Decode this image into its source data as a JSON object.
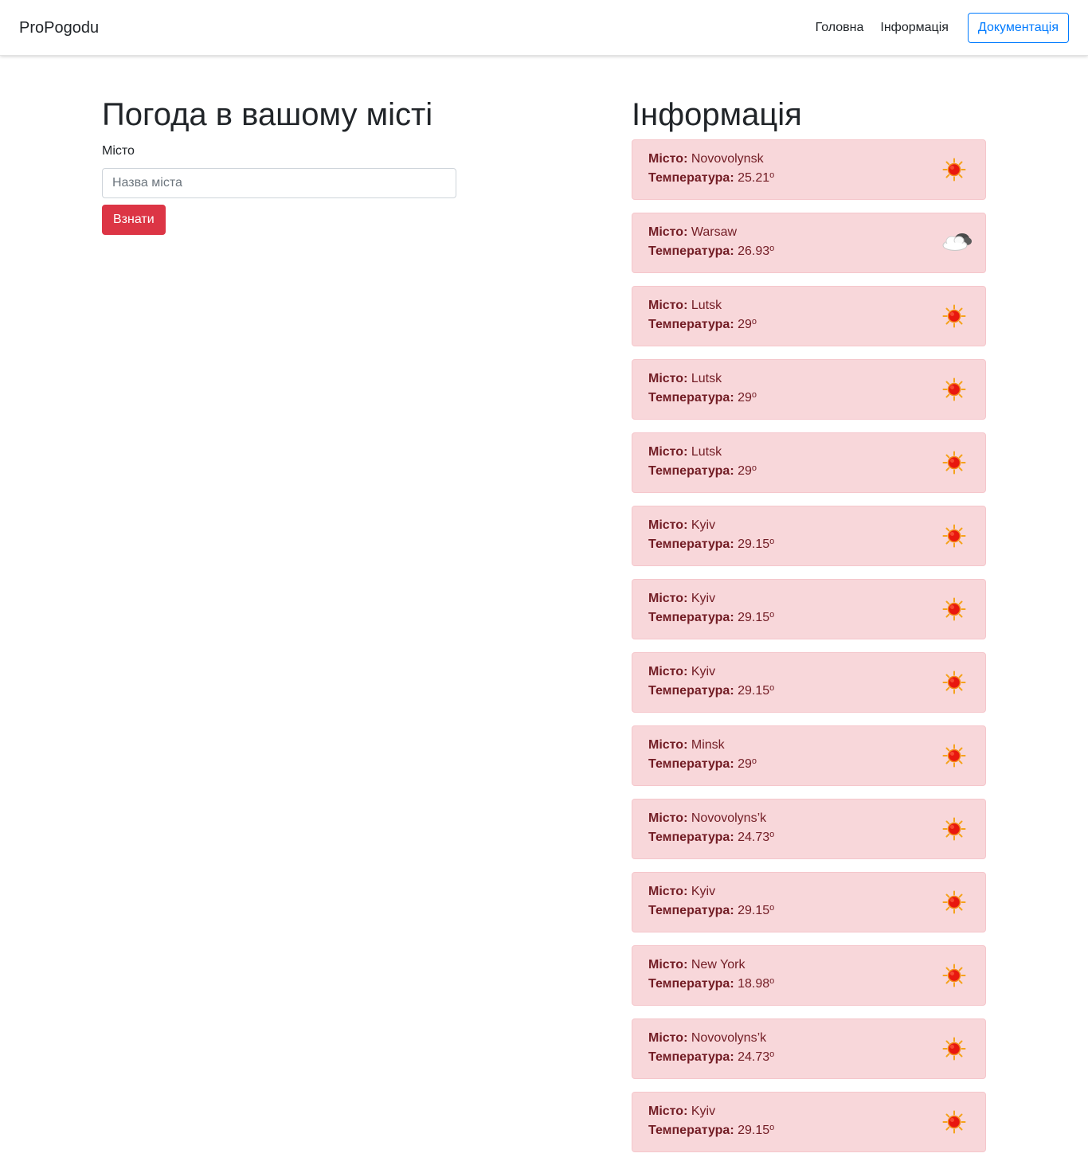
{
  "nav": {
    "brand": "ProPogodu",
    "links": [
      "Головна",
      "Інформація"
    ],
    "doc_button": "Документація"
  },
  "form": {
    "title": "Погода в вашому місті",
    "city_label": "Місто",
    "city_placeholder": "Назва міста",
    "city_value": "",
    "submit_label": "Взнати"
  },
  "info": {
    "title": "Інформація",
    "city_key": "Місто:",
    "temp_key": "Температура:",
    "degree": "o",
    "items": [
      {
        "city": "Novovolynsk",
        "temp": "25.21",
        "icon": "sun-icon"
      },
      {
        "city": "Warsaw",
        "temp": "26.93",
        "icon": "cloud-icon"
      },
      {
        "city": "Lutsk",
        "temp": "29",
        "icon": "sun-icon"
      },
      {
        "city": "Lutsk",
        "temp": "29",
        "icon": "sun-icon"
      },
      {
        "city": "Lutsk",
        "temp": "29",
        "icon": "sun-icon"
      },
      {
        "city": "Kyiv",
        "temp": "29.15",
        "icon": "sun-icon"
      },
      {
        "city": "Kyiv",
        "temp": "29.15",
        "icon": "sun-icon"
      },
      {
        "city": "Kyiv",
        "temp": "29.15",
        "icon": "sun-icon"
      },
      {
        "city": "Minsk",
        "temp": "29",
        "icon": "sun-icon"
      },
      {
        "city": "Novovolyns’k",
        "temp": "24.73",
        "icon": "sun-icon"
      },
      {
        "city": "Kyiv",
        "temp": "29.15",
        "icon": "sun-icon"
      },
      {
        "city": "New York",
        "temp": "18.98",
        "icon": "sun-icon"
      },
      {
        "city": "Novovolyns’k",
        "temp": "24.73",
        "icon": "sun-icon"
      },
      {
        "city": "Kyiv",
        "temp": "29.15",
        "icon": "sun-icon"
      }
    ]
  },
  "colors": {
    "primary": "#007bff",
    "danger": "#dc3545",
    "alert_bg": "#f8d7da",
    "alert_text": "#721c24"
  }
}
